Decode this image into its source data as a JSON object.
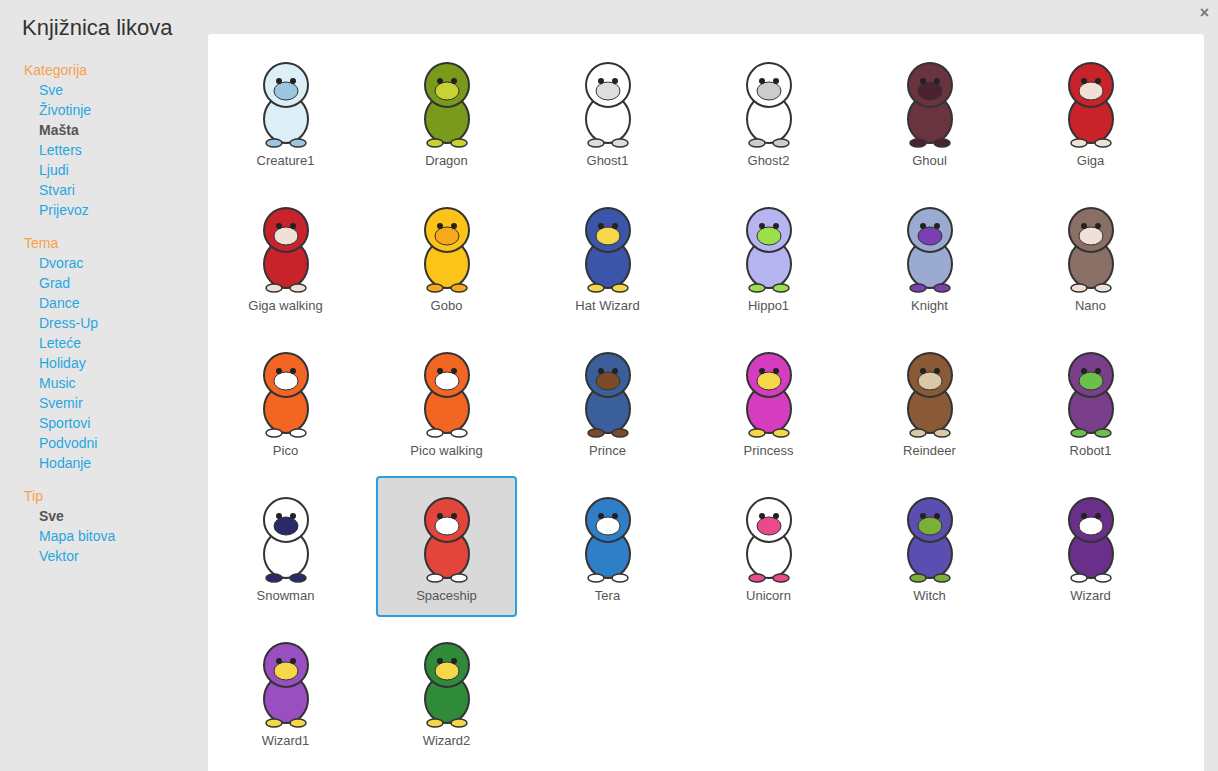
{
  "window": {
    "title": "Knjižnica likova",
    "close": "×"
  },
  "sidebar": {
    "sections": [
      {
        "title": "Kategorija",
        "items": [
          {
            "label": "Sve",
            "selected": false
          },
          {
            "label": "Životinje",
            "selected": false
          },
          {
            "label": "Mašta",
            "selected": true
          },
          {
            "label": "Letters",
            "selected": false
          },
          {
            "label": "Ljudi",
            "selected": false
          },
          {
            "label": "Stvari",
            "selected": false
          },
          {
            "label": "Prijevoz",
            "selected": false
          }
        ]
      },
      {
        "title": "Tema",
        "items": [
          {
            "label": "Dvorac",
            "selected": false
          },
          {
            "label": "Grad",
            "selected": false
          },
          {
            "label": "Dance",
            "selected": false
          },
          {
            "label": "Dress-Up",
            "selected": false
          },
          {
            "label": "Leteće",
            "selected": false
          },
          {
            "label": "Holiday",
            "selected": false
          },
          {
            "label": "Music",
            "selected": false
          },
          {
            "label": "Svemir",
            "selected": false
          },
          {
            "label": "Sportovi",
            "selected": false
          },
          {
            "label": "Podvodni",
            "selected": false
          },
          {
            "label": "Hodanje",
            "selected": false
          }
        ]
      },
      {
        "title": "Tip",
        "items": [
          {
            "label": "Sve",
            "selected": true
          },
          {
            "label": "Mapa bitova",
            "selected": false
          },
          {
            "label": "Vektor",
            "selected": false
          }
        ]
      }
    ]
  },
  "sprites": [
    {
      "name": "Creature1",
      "selected": false
    },
    {
      "name": "Dragon",
      "selected": false
    },
    {
      "name": "Ghost1",
      "selected": false
    },
    {
      "name": "Ghost2",
      "selected": false
    },
    {
      "name": "Ghoul",
      "selected": false
    },
    {
      "name": "Giga",
      "selected": false
    },
    {
      "name": "Giga walking",
      "selected": false
    },
    {
      "name": "Gobo",
      "selected": false
    },
    {
      "name": "Hat Wizard",
      "selected": false
    },
    {
      "name": "Hippo1",
      "selected": false
    },
    {
      "name": "Knight",
      "selected": false
    },
    {
      "name": "Nano",
      "selected": false
    },
    {
      "name": "Pico",
      "selected": false
    },
    {
      "name": "Pico walking",
      "selected": false
    },
    {
      "name": "Prince",
      "selected": false
    },
    {
      "name": "Princess",
      "selected": false
    },
    {
      "name": "Reindeer",
      "selected": false
    },
    {
      "name": "Robot1",
      "selected": false
    },
    {
      "name": "Snowman",
      "selected": false
    },
    {
      "name": "Spaceship",
      "selected": true
    },
    {
      "name": "Tera",
      "selected": false
    },
    {
      "name": "Unicorn",
      "selected": false
    },
    {
      "name": "Witch",
      "selected": false
    },
    {
      "name": "Wizard",
      "selected": false
    },
    {
      "name": "Wizard1",
      "selected": false
    },
    {
      "name": "Wizard2",
      "selected": false
    }
  ]
}
